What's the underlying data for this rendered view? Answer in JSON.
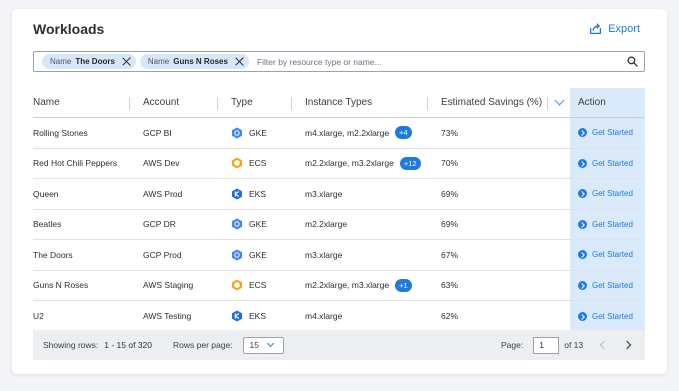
{
  "header": {
    "title": "Workloads",
    "export_label": "Export"
  },
  "filters": {
    "chips": [
      {
        "key": "Name",
        "value": "The Doors"
      },
      {
        "key": "Name",
        "value": "Guns N Roses"
      }
    ],
    "placeholder": "Filter by resource type or name..."
  },
  "columns": {
    "name": "Name",
    "account": "Account",
    "type": "Type",
    "instance_types": "Instance Types",
    "savings": "Estimated Savings (%)",
    "action": "Action"
  },
  "rows": [
    {
      "name": "Rolling Stones",
      "account": "GCP BI",
      "type": "GKE",
      "type_icon": "gke-icon",
      "instances": "m4.xlarge, m2.2xlarge",
      "extra": "+4",
      "savings": "73%",
      "action": "Get Started"
    },
    {
      "name": "Red Hot Chili Peppers",
      "account": "AWS Dev",
      "type": "ECS",
      "type_icon": "ecs-icon",
      "instances": "m2.2xlarge, m3.2xlarge",
      "extra": "+12",
      "savings": "70%",
      "action": "Get Started"
    },
    {
      "name": "Queen",
      "account": "AWS Prod",
      "type": "EKS",
      "type_icon": "eks-icon",
      "instances": "m3.xlarge",
      "extra": "",
      "savings": "69%",
      "action": "Get Started"
    },
    {
      "name": "Beatles",
      "account": "GCP DR",
      "type": "GKE",
      "type_icon": "gke-icon",
      "instances": "m2.2xlarge",
      "extra": "",
      "savings": "69%",
      "action": "Get Started"
    },
    {
      "name": "The Doors",
      "account": "GCP Prod",
      "type": "GKE",
      "type_icon": "gke-icon",
      "instances": "m3.xlarge",
      "extra": "",
      "savings": "67%",
      "action": "Get Started"
    },
    {
      "name": "Guns N Roses",
      "account": "AWS Staging",
      "type": "ECS",
      "type_icon": "ecs-icon",
      "instances": "m2.2xlarge, m3.xlarge",
      "extra": "+1",
      "savings": "63%",
      "action": "Get Started"
    },
    {
      "name": "U2",
      "account": "AWS Testing",
      "type": "EKS",
      "type_icon": "eks-icon",
      "instances": "m4.xlarge",
      "extra": "",
      "savings": "62%",
      "action": "Get Started"
    }
  ],
  "footer": {
    "showing_label": "Showing rows:",
    "showing_value": "1 - 15 of 320",
    "rpp_label": "Rows per page:",
    "rpp_value": "15",
    "page_label": "Page:",
    "page_value": "1",
    "page_total": "of 13"
  },
  "colors": {
    "accent": "#1f7ae0",
    "gke": "#4285f4",
    "ecs": "#f5a623",
    "eks": "#1f6fe0",
    "selected_column": "#dbeafb"
  }
}
